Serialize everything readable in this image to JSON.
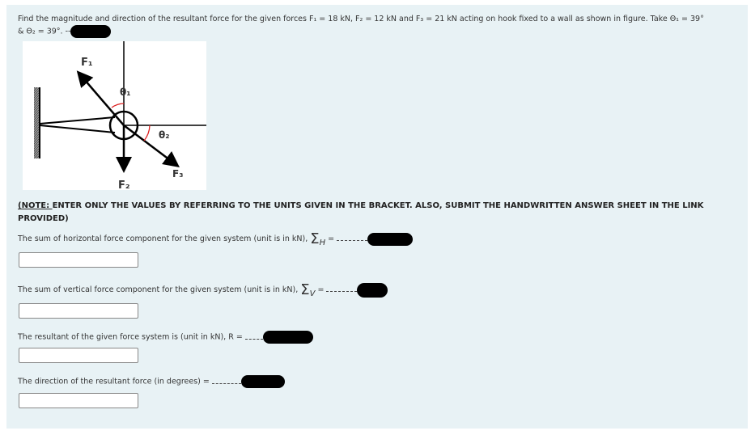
{
  "question": {
    "text_line1": "Find the magnitude and direction of the resultant force for the given forces F₁ = 18 kN, F₂ = 12 kN and F₃ = 21 kN acting on hook fixed to a wall as shown in figure. Take Θ₁ = 39°",
    "text_line2": "& Θ₂ = 39°. --"
  },
  "figure": {
    "labels": {
      "f1": "F₁",
      "f2": "F₂",
      "f3": "F₃",
      "theta1": "θ₁",
      "theta2": "θ₂"
    },
    "angle_color": "#d22"
  },
  "note": {
    "prefix": "(NOTE: ",
    "text": "ENTER ONLY THE VALUES BY REFERRING TO THE UNITS GIVEN IN THE BRACKET.  ALSO, SUBMIT THE HANDWRITTEN ANSWER SHEET IN THE LINK PROVIDED)"
  },
  "questions": [
    {
      "label": "The sum of horizontal force component for the given system (unit is in kN), ",
      "symbol": "Σ",
      "sub": "H",
      "suffix": " =",
      "value": ""
    },
    {
      "label": "The sum of vertical force component for the given system (unit is in kN), ",
      "symbol": "Σ",
      "sub": "V",
      "suffix": " =",
      "value": ""
    },
    {
      "label": "The resultant of the given force system is (unit in kN), R =",
      "value": ""
    },
    {
      "label": "The direction of the resultant force (in degrees) =",
      "value": ""
    }
  ]
}
